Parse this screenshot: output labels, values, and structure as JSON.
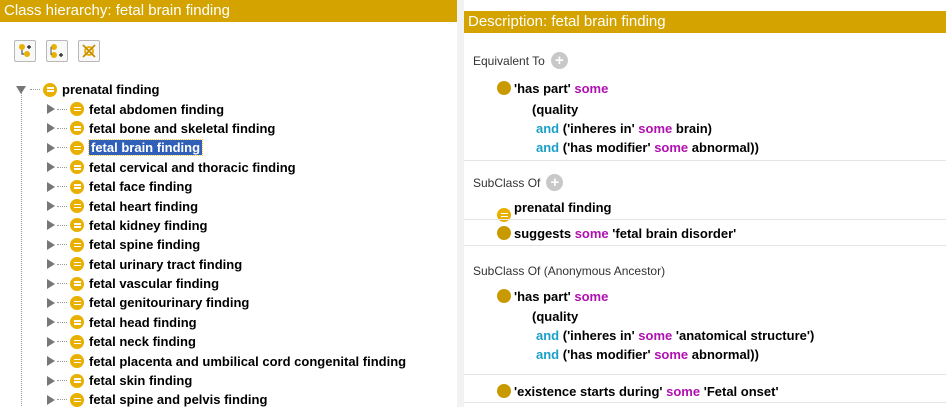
{
  "left_panel": {
    "title": "Class hierarchy: fetal brain finding",
    "toolbar": [
      {
        "name": "add-subclass-icon"
      },
      {
        "name": "add-sibling-icon"
      },
      {
        "name": "delete-class-icon"
      }
    ],
    "tree": {
      "root": "prenatal finding",
      "children": [
        {
          "label": "fetal abdomen finding"
        },
        {
          "label": "fetal bone and skeletal finding"
        },
        {
          "label": "fetal brain finding",
          "selected": true
        },
        {
          "label": "fetal cervical and thoracic finding"
        },
        {
          "label": "fetal face finding"
        },
        {
          "label": "fetal heart finding"
        },
        {
          "label": "fetal kidney finding"
        },
        {
          "label": "fetal spine finding"
        },
        {
          "label": "fetal urinary tract finding"
        },
        {
          "label": "fetal vascular finding"
        },
        {
          "label": "fetal genitourinary finding"
        },
        {
          "label": "fetal head finding"
        },
        {
          "label": "fetal neck finding"
        },
        {
          "label": "fetal placenta and umbilical cord congenital finding"
        },
        {
          "label": "fetal skin finding"
        },
        {
          "label": "fetal spine and pelvis finding"
        }
      ]
    }
  },
  "right_panel": {
    "title": "Description: fetal brain finding",
    "equivalent_to": {
      "header": "Equivalent To",
      "line1": {
        "prop": "'has part'",
        "kw": "some"
      },
      "line2": "(quality",
      "line3": {
        "and": "and",
        "prop": "('inheres in'",
        "kw": "some",
        "val": "brain)"
      },
      "line4": {
        "and": "and",
        "prop": "('has modifier'",
        "kw": "some",
        "val": "abnormal))"
      }
    },
    "subclass_of": {
      "header": "SubClass Of",
      "item1": "prenatal finding",
      "item2": {
        "prop": "suggests",
        "kw": "some",
        "val": "'fetal brain disorder'"
      }
    },
    "anon_ancestor": {
      "header": "SubClass Of (Anonymous Ancestor)",
      "line1": {
        "prop": "'has part'",
        "kw": "some"
      },
      "line2": "(quality",
      "line3": {
        "and": "and",
        "prop": "('inheres in'",
        "kw": "some",
        "val": "'anatomical structure')"
      },
      "line4": {
        "and": "and",
        "prop": "('has modifier'",
        "kw": "some",
        "val": "abnormal))"
      },
      "item2": {
        "prop": "'existence starts during'",
        "kw": "some",
        "val": "'Fetal onset'"
      }
    },
    "colors": {
      "header": "#d4a300",
      "keyword": "#b010b0",
      "and": "#1aa0c8",
      "selection": "#2f5fb8"
    }
  }
}
